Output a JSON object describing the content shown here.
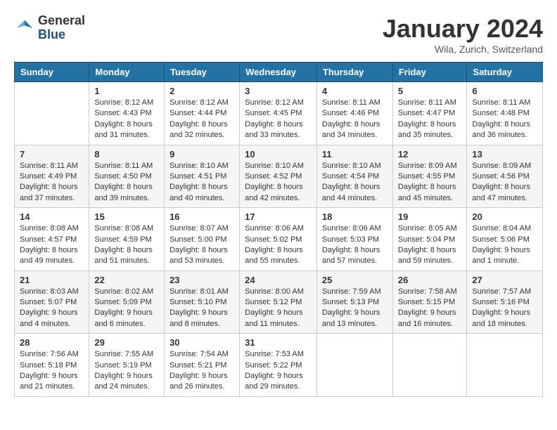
{
  "logo": {
    "general": "General",
    "blue": "Blue"
  },
  "title": "January 2024",
  "location": "Wila, Zurich, Switzerland",
  "weekdays": [
    "Sunday",
    "Monday",
    "Tuesday",
    "Wednesday",
    "Thursday",
    "Friday",
    "Saturday"
  ],
  "weeks": [
    [
      {
        "day": "",
        "sunrise": "",
        "sunset": "",
        "daylight": ""
      },
      {
        "day": "1",
        "sunrise": "Sunrise: 8:12 AM",
        "sunset": "Sunset: 4:43 PM",
        "daylight": "Daylight: 8 hours and 31 minutes."
      },
      {
        "day": "2",
        "sunrise": "Sunrise: 8:12 AM",
        "sunset": "Sunset: 4:44 PM",
        "daylight": "Daylight: 8 hours and 32 minutes."
      },
      {
        "day": "3",
        "sunrise": "Sunrise: 8:12 AM",
        "sunset": "Sunset: 4:45 PM",
        "daylight": "Daylight: 8 hours and 33 minutes."
      },
      {
        "day": "4",
        "sunrise": "Sunrise: 8:11 AM",
        "sunset": "Sunset: 4:46 PM",
        "daylight": "Daylight: 8 hours and 34 minutes."
      },
      {
        "day": "5",
        "sunrise": "Sunrise: 8:11 AM",
        "sunset": "Sunset: 4:47 PM",
        "daylight": "Daylight: 8 hours and 35 minutes."
      },
      {
        "day": "6",
        "sunrise": "Sunrise: 8:11 AM",
        "sunset": "Sunset: 4:48 PM",
        "daylight": "Daylight: 8 hours and 36 minutes."
      }
    ],
    [
      {
        "day": "7",
        "sunrise": "Sunrise: 8:11 AM",
        "sunset": "Sunset: 4:49 PM",
        "daylight": "Daylight: 8 hours and 37 minutes."
      },
      {
        "day": "8",
        "sunrise": "Sunrise: 8:11 AM",
        "sunset": "Sunset: 4:50 PM",
        "daylight": "Daylight: 8 hours and 39 minutes."
      },
      {
        "day": "9",
        "sunrise": "Sunrise: 8:10 AM",
        "sunset": "Sunset: 4:51 PM",
        "daylight": "Daylight: 8 hours and 40 minutes."
      },
      {
        "day": "10",
        "sunrise": "Sunrise: 8:10 AM",
        "sunset": "Sunset: 4:52 PM",
        "daylight": "Daylight: 8 hours and 42 minutes."
      },
      {
        "day": "11",
        "sunrise": "Sunrise: 8:10 AM",
        "sunset": "Sunset: 4:54 PM",
        "daylight": "Daylight: 8 hours and 44 minutes."
      },
      {
        "day": "12",
        "sunrise": "Sunrise: 8:09 AM",
        "sunset": "Sunset: 4:55 PM",
        "daylight": "Daylight: 8 hours and 45 minutes."
      },
      {
        "day": "13",
        "sunrise": "Sunrise: 8:09 AM",
        "sunset": "Sunset: 4:56 PM",
        "daylight": "Daylight: 8 hours and 47 minutes."
      }
    ],
    [
      {
        "day": "14",
        "sunrise": "Sunrise: 8:08 AM",
        "sunset": "Sunset: 4:57 PM",
        "daylight": "Daylight: 8 hours and 49 minutes."
      },
      {
        "day": "15",
        "sunrise": "Sunrise: 8:08 AM",
        "sunset": "Sunset: 4:59 PM",
        "daylight": "Daylight: 8 hours and 51 minutes."
      },
      {
        "day": "16",
        "sunrise": "Sunrise: 8:07 AM",
        "sunset": "Sunset: 5:00 PM",
        "daylight": "Daylight: 8 hours and 53 minutes."
      },
      {
        "day": "17",
        "sunrise": "Sunrise: 8:06 AM",
        "sunset": "Sunset: 5:02 PM",
        "daylight": "Daylight: 8 hours and 55 minutes."
      },
      {
        "day": "18",
        "sunrise": "Sunrise: 8:06 AM",
        "sunset": "Sunset: 5:03 PM",
        "daylight": "Daylight: 8 hours and 57 minutes."
      },
      {
        "day": "19",
        "sunrise": "Sunrise: 8:05 AM",
        "sunset": "Sunset: 5:04 PM",
        "daylight": "Daylight: 8 hours and 59 minutes."
      },
      {
        "day": "20",
        "sunrise": "Sunrise: 8:04 AM",
        "sunset": "Sunset: 5:06 PM",
        "daylight": "Daylight: 9 hours and 1 minute."
      }
    ],
    [
      {
        "day": "21",
        "sunrise": "Sunrise: 8:03 AM",
        "sunset": "Sunset: 5:07 PM",
        "daylight": "Daylight: 9 hours and 4 minutes."
      },
      {
        "day": "22",
        "sunrise": "Sunrise: 8:02 AM",
        "sunset": "Sunset: 5:09 PM",
        "daylight": "Daylight: 9 hours and 6 minutes."
      },
      {
        "day": "23",
        "sunrise": "Sunrise: 8:01 AM",
        "sunset": "Sunset: 5:10 PM",
        "daylight": "Daylight: 9 hours and 8 minutes."
      },
      {
        "day": "24",
        "sunrise": "Sunrise: 8:00 AM",
        "sunset": "Sunset: 5:12 PM",
        "daylight": "Daylight: 9 hours and 11 minutes."
      },
      {
        "day": "25",
        "sunrise": "Sunrise: 7:59 AM",
        "sunset": "Sunset: 5:13 PM",
        "daylight": "Daylight: 9 hours and 13 minutes."
      },
      {
        "day": "26",
        "sunrise": "Sunrise: 7:58 AM",
        "sunset": "Sunset: 5:15 PM",
        "daylight": "Daylight: 9 hours and 16 minutes."
      },
      {
        "day": "27",
        "sunrise": "Sunrise: 7:57 AM",
        "sunset": "Sunset: 5:16 PM",
        "daylight": "Daylight: 9 hours and 18 minutes."
      }
    ],
    [
      {
        "day": "28",
        "sunrise": "Sunrise: 7:56 AM",
        "sunset": "Sunset: 5:18 PM",
        "daylight": "Daylight: 9 hours and 21 minutes."
      },
      {
        "day": "29",
        "sunrise": "Sunrise: 7:55 AM",
        "sunset": "Sunset: 5:19 PM",
        "daylight": "Daylight: 9 hours and 24 minutes."
      },
      {
        "day": "30",
        "sunrise": "Sunrise: 7:54 AM",
        "sunset": "Sunset: 5:21 PM",
        "daylight": "Daylight: 9 hours and 26 minutes."
      },
      {
        "day": "31",
        "sunrise": "Sunrise: 7:53 AM",
        "sunset": "Sunset: 5:22 PM",
        "daylight": "Daylight: 9 hours and 29 minutes."
      },
      {
        "day": "",
        "sunrise": "",
        "sunset": "",
        "daylight": ""
      },
      {
        "day": "",
        "sunrise": "",
        "sunset": "",
        "daylight": ""
      },
      {
        "day": "",
        "sunrise": "",
        "sunset": "",
        "daylight": ""
      }
    ]
  ]
}
